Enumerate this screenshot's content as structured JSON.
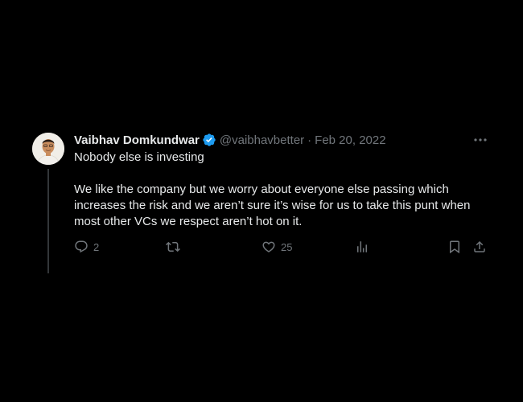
{
  "tweet": {
    "author_name": "Vaibhav Domkundwar",
    "handle": "@vaibhavbetter",
    "separator": "·",
    "date": "Feb 20, 2022",
    "verified": true,
    "paragraphs": [
      "Nobody else is investing",
      "We like the company but we worry about everyone else passing which increases the risk and we aren’t sure it’s wise for us to take this punt when most other VCs we respect aren’t hot on it."
    ],
    "actions": {
      "replies": "2",
      "retweets": "",
      "likes": "25",
      "views": ""
    }
  },
  "icons": {
    "verified": "verified-badge-icon",
    "more": "more-horizontal-icon",
    "reply": "reply-icon",
    "retweet": "retweet-icon",
    "like": "heart-icon",
    "views": "analytics-icon",
    "bookmark": "bookmark-icon",
    "share": "share-icon"
  },
  "colors": {
    "background": "#000000",
    "text": "#e7e9ea",
    "muted": "#71767b",
    "verified": "#1d9bf0",
    "thread_line": "#333639"
  }
}
